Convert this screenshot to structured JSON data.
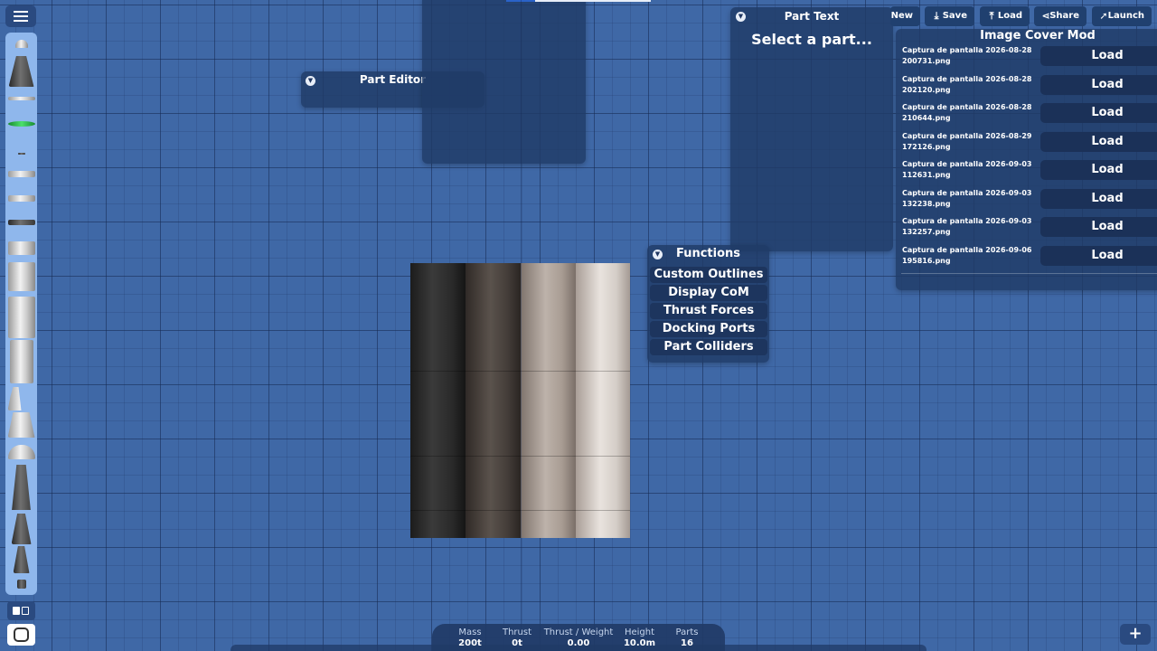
{
  "part_editor": {
    "title": "Part Editor"
  },
  "part_text": {
    "title": "Part Text",
    "placeholder": "Select a part..."
  },
  "functions": {
    "title": "Functions",
    "buttons": [
      "Custom Outlines",
      "Display CoM",
      "Thrust Forces",
      "Docking Ports",
      "Part Colliders"
    ]
  },
  "toolbar": {
    "new_label": "New",
    "save_label": "Save",
    "load_label": "Load",
    "share_label": "Share",
    "launch_label": "Launch"
  },
  "image_cover": {
    "title": "Image Cover Mod",
    "load_label": "Load",
    "files": [
      {
        "line1": "Captura de pantalla 2026-08-28",
        "line2": "200731.png"
      },
      {
        "line1": "Captura de pantalla 2026-08-28",
        "line2": "202120.png"
      },
      {
        "line1": "Captura de pantalla 2026-08-28",
        "line2": "210644.png"
      },
      {
        "line1": "Captura de pantalla 2026-08-29",
        "line2": "172126.png"
      },
      {
        "line1": "Captura de pantalla 2026-09-03",
        "line2": "112631.png"
      },
      {
        "line1": "Captura de pantalla 2026-09-03",
        "line2": "132238.png"
      },
      {
        "line1": "Captura de pantalla 2026-09-03",
        "line2": "132257.png"
      },
      {
        "line1": "Captura de pantalla 2026-09-06",
        "line2": "195816.png"
      }
    ]
  },
  "stats": {
    "mass": {
      "label": "Mass",
      "value": "200t"
    },
    "thrust": {
      "label": "Thrust",
      "value": "0t"
    },
    "twr": {
      "label": "Thrust / Weight",
      "value": "0.00"
    },
    "height": {
      "label": "Height",
      "value": "10.0m"
    },
    "parts": {
      "label": "Parts",
      "value": "16"
    }
  },
  "icons": {
    "menu": "hamburger-icon",
    "add": "plus-icon",
    "save": "download-icon",
    "load": "upload-icon",
    "share": "share-icon",
    "launch": "rocket-icon",
    "collapse": "triangle-down-icon"
  },
  "colors": {
    "background": "#3f68a6",
    "panel": "#203a66",
    "palette": "#8fb7ec",
    "button": "#1d355e"
  }
}
